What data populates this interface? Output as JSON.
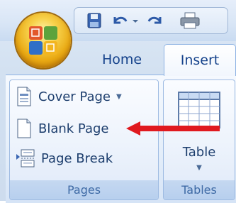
{
  "tabs": [
    {
      "label": "Home"
    },
    {
      "label": "Insert"
    }
  ],
  "groups": {
    "pages": {
      "label": "Pages",
      "commands": [
        {
          "label": "Cover Page",
          "icon": "cover-page-icon",
          "has_dropdown": true
        },
        {
          "label": "Blank Page",
          "icon": "blank-page-icon"
        },
        {
          "label": "Page Break",
          "icon": "page-break-icon"
        }
      ]
    },
    "tables": {
      "label": "Tables",
      "command": {
        "label": "Table",
        "icon": "table-icon",
        "has_dropdown": true
      }
    }
  },
  "quick_access": [
    "save-icon",
    "undo-icon",
    "redo-icon",
    "print-icon"
  ],
  "colors": {
    "tab_text": "#15428b",
    "arrow": "#e0191f",
    "group_label": "#3e6aa5"
  }
}
